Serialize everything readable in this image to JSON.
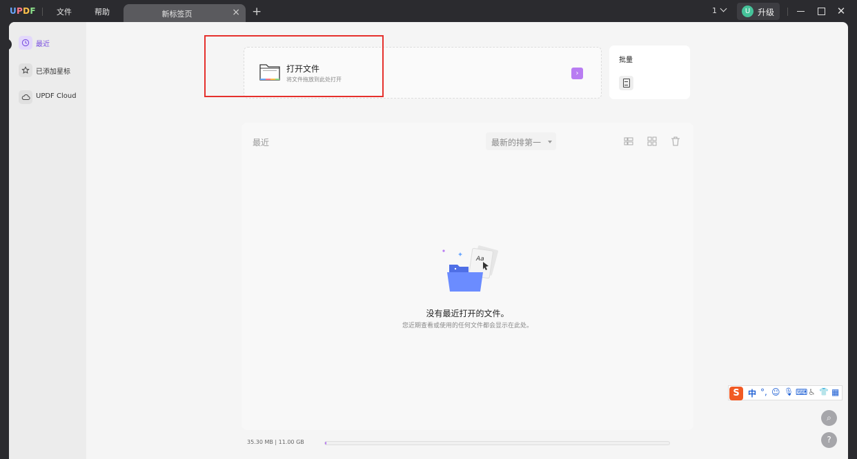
{
  "app": {
    "logo": "UPDF"
  },
  "menu": {
    "file": "文件",
    "help": "帮助"
  },
  "tab": {
    "title": "新标签页",
    "close": "×",
    "new": "+"
  },
  "header": {
    "doc_count": "1",
    "upgrade_avatar": "U",
    "upgrade_label": "升级"
  },
  "window_controls": {
    "close": "✕"
  },
  "sidebar": {
    "items": [
      {
        "label": "最近",
        "icon": "clock-icon",
        "active": true
      },
      {
        "label": "已添加星标",
        "icon": "star-icon",
        "active": false
      },
      {
        "label": "UPDF Cloud",
        "icon": "cloud-icon",
        "active": false
      }
    ]
  },
  "open_file": {
    "title": "打开文件",
    "subtitle": "将文件拖放到此处打开",
    "arrow": "›"
  },
  "batch": {
    "title": "批量"
  },
  "recent": {
    "title": "最近",
    "sort_label": "最新的排第一",
    "empty_title": "没有最近打开的文件。",
    "empty_subtitle": "您近期查看或使用的任何文件都会显示在此处。"
  },
  "storage": {
    "text": "35.30 MB | 11.00 GB",
    "used_fraction": 0.0032
  },
  "ime": {
    "logo": "S",
    "items": [
      "中",
      "°,",
      "☺",
      "🎙",
      "⌨",
      "♿",
      "👕",
      "▦"
    ]
  },
  "floating": {
    "search": "⌕",
    "help": "?"
  },
  "colors": {
    "accent": "#b87cf2",
    "highlight": "#e5302c",
    "title_bar": "#2b2b2f"
  }
}
